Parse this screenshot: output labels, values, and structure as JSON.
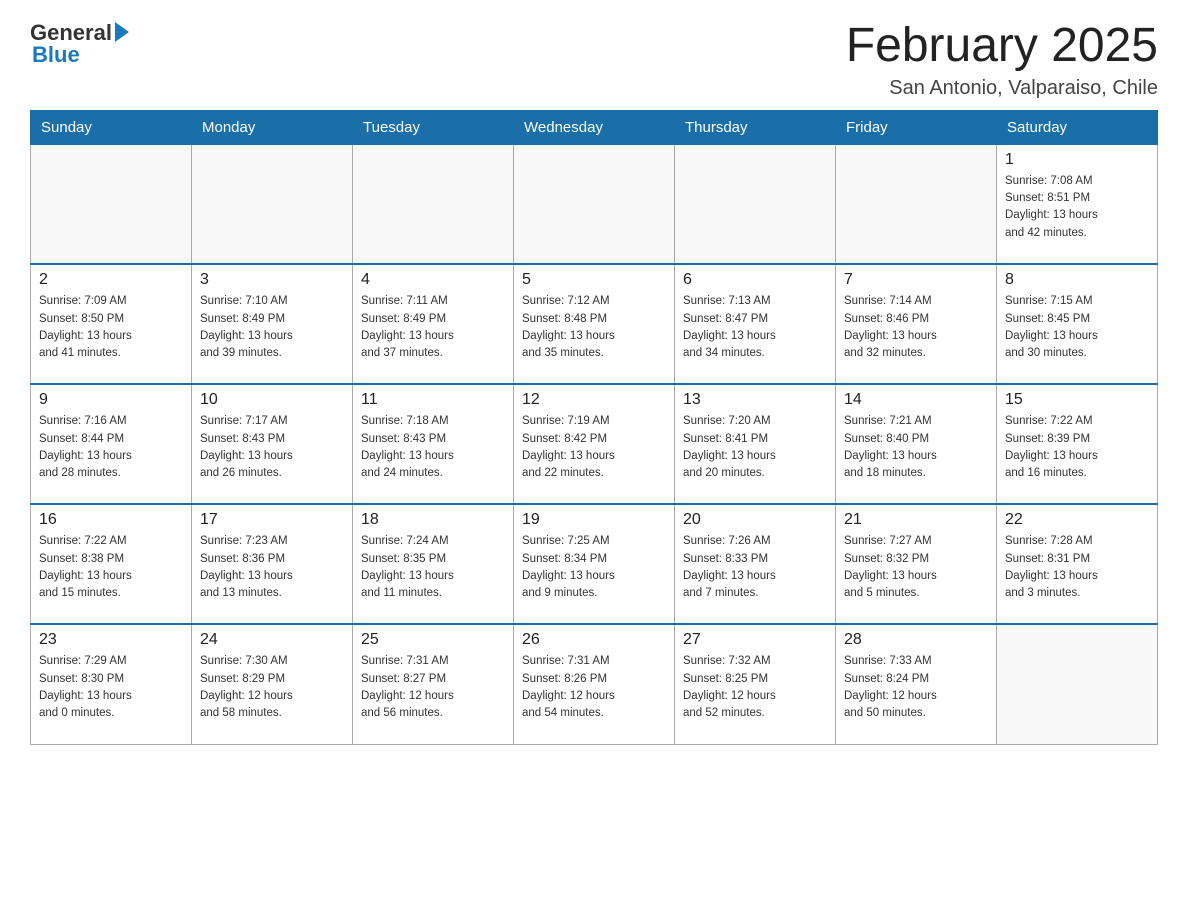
{
  "header": {
    "logo_general": "General",
    "logo_blue": "Blue",
    "month_title": "February 2025",
    "location": "San Antonio, Valparaiso, Chile"
  },
  "weekdays": [
    "Sunday",
    "Monday",
    "Tuesday",
    "Wednesday",
    "Thursday",
    "Friday",
    "Saturday"
  ],
  "weeks": [
    [
      {
        "day": "",
        "info": ""
      },
      {
        "day": "",
        "info": ""
      },
      {
        "day": "",
        "info": ""
      },
      {
        "day": "",
        "info": ""
      },
      {
        "day": "",
        "info": ""
      },
      {
        "day": "",
        "info": ""
      },
      {
        "day": "1",
        "info": "Sunrise: 7:08 AM\nSunset: 8:51 PM\nDaylight: 13 hours\nand 42 minutes."
      }
    ],
    [
      {
        "day": "2",
        "info": "Sunrise: 7:09 AM\nSunset: 8:50 PM\nDaylight: 13 hours\nand 41 minutes."
      },
      {
        "day": "3",
        "info": "Sunrise: 7:10 AM\nSunset: 8:49 PM\nDaylight: 13 hours\nand 39 minutes."
      },
      {
        "day": "4",
        "info": "Sunrise: 7:11 AM\nSunset: 8:49 PM\nDaylight: 13 hours\nand 37 minutes."
      },
      {
        "day": "5",
        "info": "Sunrise: 7:12 AM\nSunset: 8:48 PM\nDaylight: 13 hours\nand 35 minutes."
      },
      {
        "day": "6",
        "info": "Sunrise: 7:13 AM\nSunset: 8:47 PM\nDaylight: 13 hours\nand 34 minutes."
      },
      {
        "day": "7",
        "info": "Sunrise: 7:14 AM\nSunset: 8:46 PM\nDaylight: 13 hours\nand 32 minutes."
      },
      {
        "day": "8",
        "info": "Sunrise: 7:15 AM\nSunset: 8:45 PM\nDaylight: 13 hours\nand 30 minutes."
      }
    ],
    [
      {
        "day": "9",
        "info": "Sunrise: 7:16 AM\nSunset: 8:44 PM\nDaylight: 13 hours\nand 28 minutes."
      },
      {
        "day": "10",
        "info": "Sunrise: 7:17 AM\nSunset: 8:43 PM\nDaylight: 13 hours\nand 26 minutes."
      },
      {
        "day": "11",
        "info": "Sunrise: 7:18 AM\nSunset: 8:43 PM\nDaylight: 13 hours\nand 24 minutes."
      },
      {
        "day": "12",
        "info": "Sunrise: 7:19 AM\nSunset: 8:42 PM\nDaylight: 13 hours\nand 22 minutes."
      },
      {
        "day": "13",
        "info": "Sunrise: 7:20 AM\nSunset: 8:41 PM\nDaylight: 13 hours\nand 20 minutes."
      },
      {
        "day": "14",
        "info": "Sunrise: 7:21 AM\nSunset: 8:40 PM\nDaylight: 13 hours\nand 18 minutes."
      },
      {
        "day": "15",
        "info": "Sunrise: 7:22 AM\nSunset: 8:39 PM\nDaylight: 13 hours\nand 16 minutes."
      }
    ],
    [
      {
        "day": "16",
        "info": "Sunrise: 7:22 AM\nSunset: 8:38 PM\nDaylight: 13 hours\nand 15 minutes."
      },
      {
        "day": "17",
        "info": "Sunrise: 7:23 AM\nSunset: 8:36 PM\nDaylight: 13 hours\nand 13 minutes."
      },
      {
        "day": "18",
        "info": "Sunrise: 7:24 AM\nSunset: 8:35 PM\nDaylight: 13 hours\nand 11 minutes."
      },
      {
        "day": "19",
        "info": "Sunrise: 7:25 AM\nSunset: 8:34 PM\nDaylight: 13 hours\nand 9 minutes."
      },
      {
        "day": "20",
        "info": "Sunrise: 7:26 AM\nSunset: 8:33 PM\nDaylight: 13 hours\nand 7 minutes."
      },
      {
        "day": "21",
        "info": "Sunrise: 7:27 AM\nSunset: 8:32 PM\nDaylight: 13 hours\nand 5 minutes."
      },
      {
        "day": "22",
        "info": "Sunrise: 7:28 AM\nSunset: 8:31 PM\nDaylight: 13 hours\nand 3 minutes."
      }
    ],
    [
      {
        "day": "23",
        "info": "Sunrise: 7:29 AM\nSunset: 8:30 PM\nDaylight: 13 hours\nand 0 minutes."
      },
      {
        "day": "24",
        "info": "Sunrise: 7:30 AM\nSunset: 8:29 PM\nDaylight: 12 hours\nand 58 minutes."
      },
      {
        "day": "25",
        "info": "Sunrise: 7:31 AM\nSunset: 8:27 PM\nDaylight: 12 hours\nand 56 minutes."
      },
      {
        "day": "26",
        "info": "Sunrise: 7:31 AM\nSunset: 8:26 PM\nDaylight: 12 hours\nand 54 minutes."
      },
      {
        "day": "27",
        "info": "Sunrise: 7:32 AM\nSunset: 8:25 PM\nDaylight: 12 hours\nand 52 minutes."
      },
      {
        "day": "28",
        "info": "Sunrise: 7:33 AM\nSunset: 8:24 PM\nDaylight: 12 hours\nand 50 minutes."
      },
      {
        "day": "",
        "info": ""
      }
    ]
  ]
}
